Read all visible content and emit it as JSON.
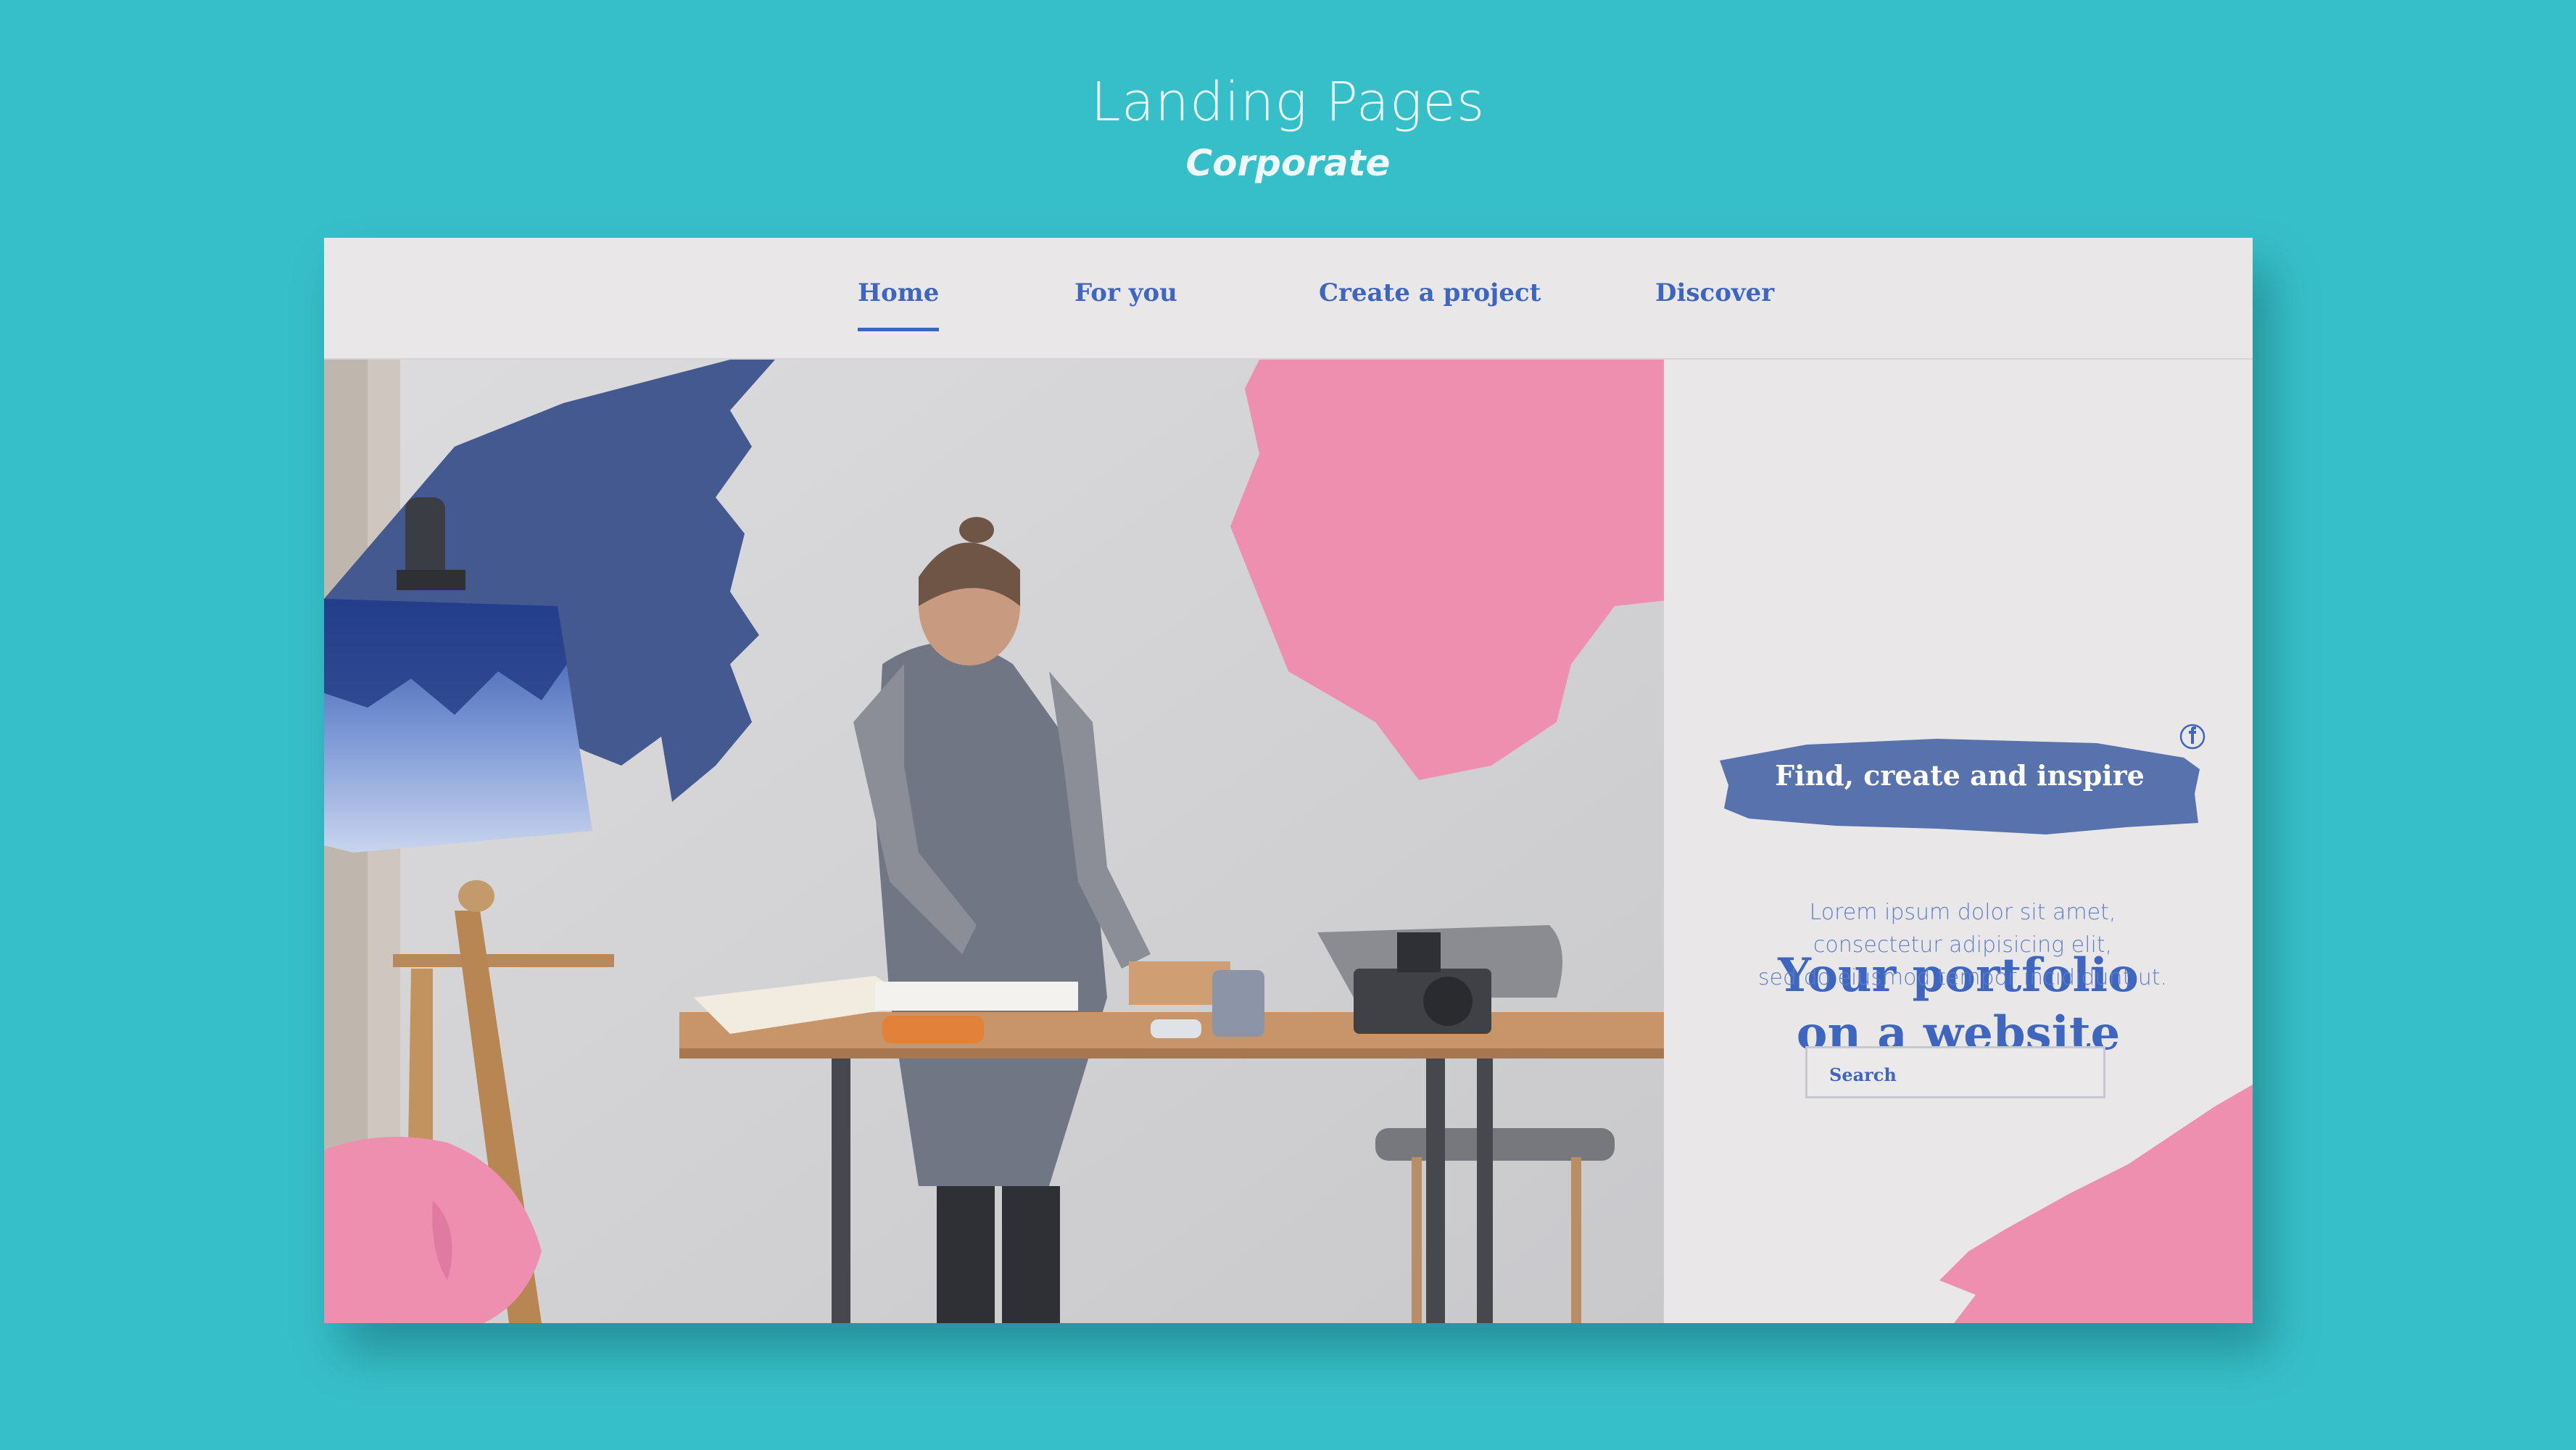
{
  "showcase": {
    "title": "Landing Pages",
    "subtitle": "Corporate"
  },
  "nav": {
    "items": [
      {
        "label": "Home",
        "active": true
      },
      {
        "label": "For you",
        "active": false
      },
      {
        "label": "Create a project",
        "active": false
      },
      {
        "label": "Discover",
        "active": false
      }
    ]
  },
  "social": {
    "icons": [
      "facebook-icon",
      "instagram-icon",
      "youtube-icon"
    ]
  },
  "hero": {
    "headline_line1": "Your portfolio",
    "headline_line2": "on a website",
    "cta_label": "Find, create and inspire",
    "body_line1": "Lorem ipsum dolor sit amet,",
    "body_line2": "consectetur adipisicing elit,",
    "body_line3": "sed do eiusmod tempor incididunt ut.",
    "search_placeholder": "Search"
  },
  "colors": {
    "background": "#37bfc9",
    "panel": "#e9e7e8",
    "accent_blue": "#3f66be",
    "brush_navy": "#44598f",
    "brush_pink": "#ee8fb0"
  }
}
